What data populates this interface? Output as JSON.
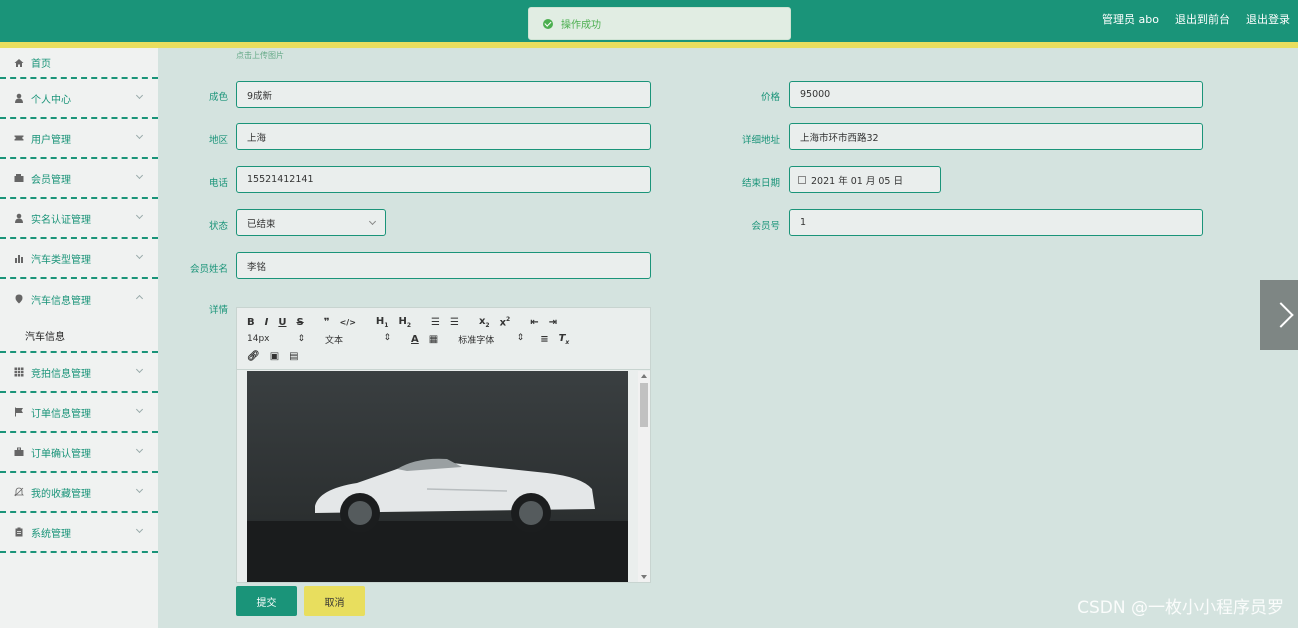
{
  "header": {
    "admin_label": "管理员 abo",
    "to_front_label": "退出到前台",
    "logout_label": "退出登录"
  },
  "toast": {
    "message": "操作成功"
  },
  "sidebar": {
    "items": [
      {
        "label": "首页"
      },
      {
        "label": "个人中心"
      },
      {
        "label": "用户管理"
      },
      {
        "label": "会员管理"
      },
      {
        "label": "实名认证管理"
      },
      {
        "label": "汽车类型管理"
      },
      {
        "label": "汽车信息管理"
      },
      {
        "label": "竞拍信息管理"
      },
      {
        "label": "订单信息管理"
      },
      {
        "label": "订单确认管理"
      },
      {
        "label": "我的收藏管理"
      },
      {
        "label": "系统管理"
      }
    ],
    "sub_item": "汽车信息"
  },
  "form": {
    "upload_hint": "点击上传图片",
    "condition_label": "成色",
    "condition_value": "9成新",
    "price_label": "价格",
    "price_value": "95000",
    "region_label": "地区",
    "region_value": "上海",
    "address_label": "详细地址",
    "address_value": "上海市环市西路32",
    "phone_label": "电话",
    "phone_value": "15521412141",
    "end_date_label": "结束日期",
    "end_date_value": "2021 年 01 月 05 日",
    "status_label": "状态",
    "status_value": "已结束",
    "member_no_label": "会员号",
    "member_no_value": "1",
    "member_name_label": "会员姓名",
    "member_name_value": "李铭",
    "details_label": "详情"
  },
  "editor": {
    "font_size": "14px",
    "text_type": "文本",
    "font_family": "标准字体"
  },
  "buttons": {
    "submit": "提交",
    "cancel": "取消"
  },
  "watermark": "CSDN @一枚小小程序员罗"
}
